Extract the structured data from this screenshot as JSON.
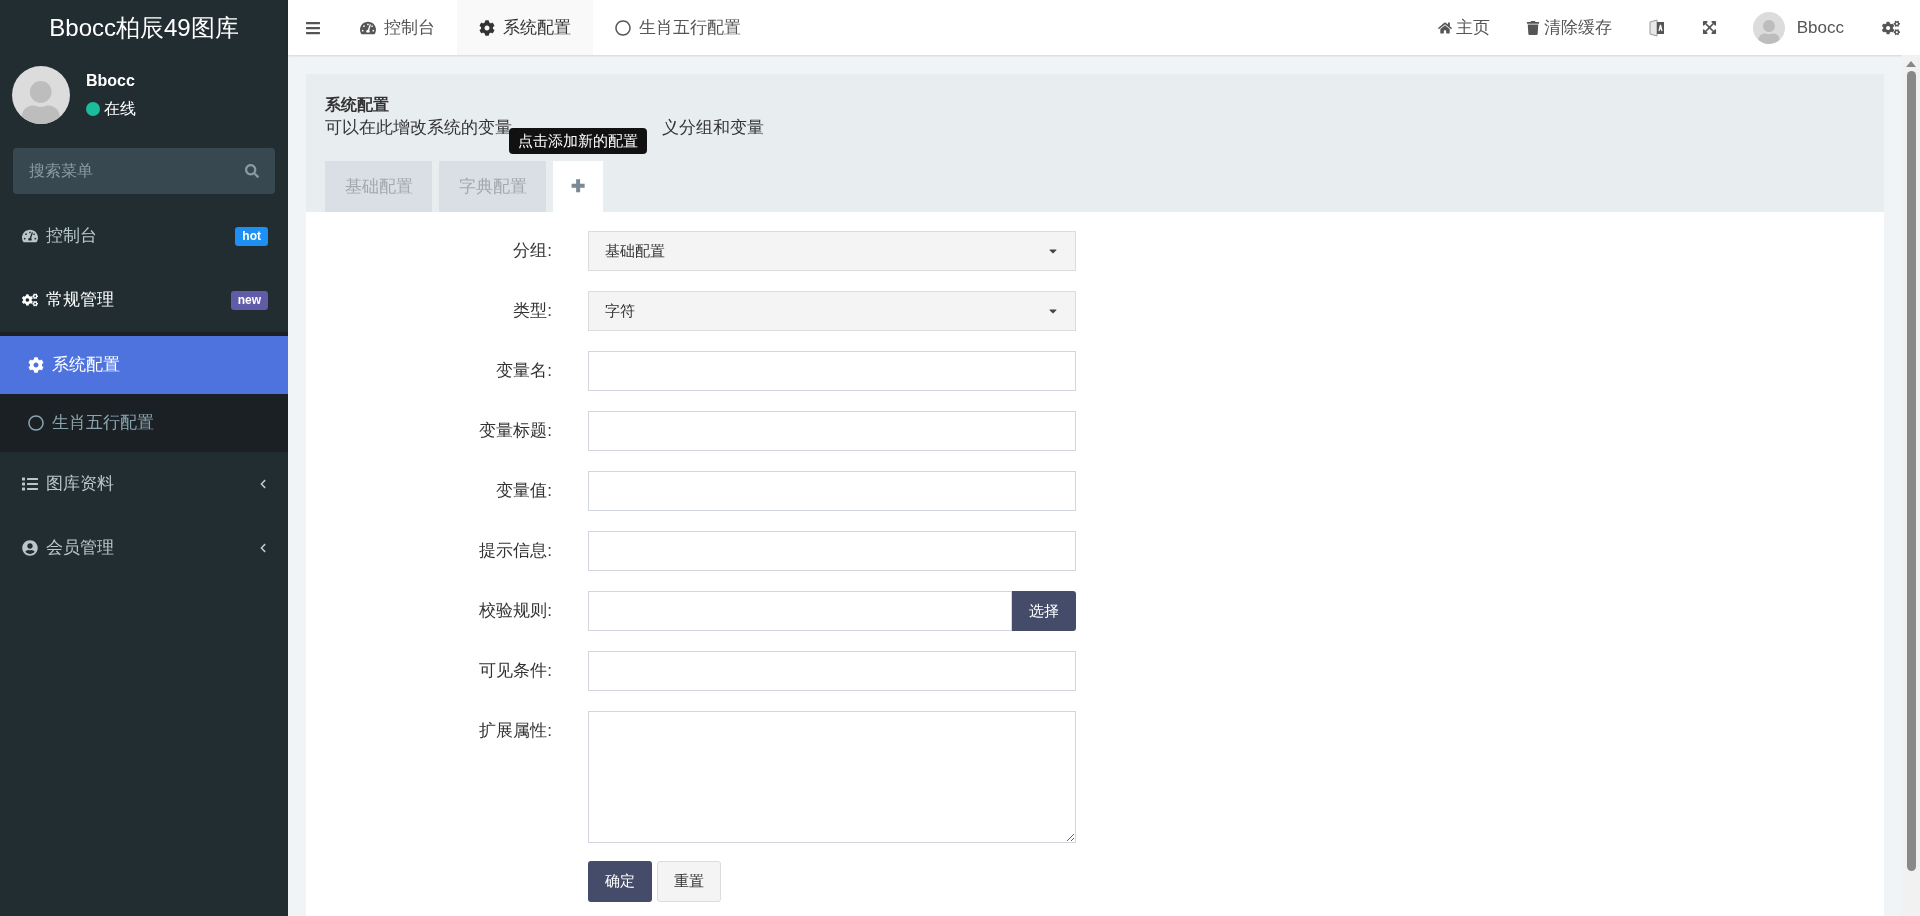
{
  "sidebar": {
    "logo": "Bbocc柏辰49图库",
    "user": {
      "name": "Bbocc",
      "status": "在线",
      "online": true
    },
    "search": {
      "placeholder": "搜索菜单"
    },
    "items": [
      {
        "label": "控制台",
        "badge": "hot",
        "color": "#1e90f4",
        "selected": false
      },
      {
        "label": "常规管理",
        "badge": "new",
        "color": "#605ca8",
        "selected": false,
        "expanded": true,
        "children": [
          {
            "label": "系统配置",
            "selected": true
          },
          {
            "label": "生肖五行配置",
            "selected": false
          }
        ]
      },
      {
        "label": "图库资料",
        "selected": false,
        "expanded": false
      },
      {
        "label": "会员管理",
        "selected": false,
        "expanded": false
      }
    ]
  },
  "topbar": {
    "tabs": [
      {
        "label": "控制台",
        "selected": false
      },
      {
        "label": "系统配置",
        "selected": true
      },
      {
        "label": "生肖五行配置",
        "selected": false
      }
    ],
    "links": [
      {
        "label": "主页"
      },
      {
        "label": "清除缓存"
      }
    ],
    "user": "Bbocc"
  },
  "panel": {
    "title": "系统配置",
    "subtitle_start": "可以在此增改系统的变量",
    "subtitle_end": "义分组和变量",
    "tooltip": "点击添加新的配置",
    "tabs": [
      {
        "label": "基础配置",
        "selected": false
      },
      {
        "label": "字典配置",
        "selected": false
      },
      {
        "label": "✚",
        "selected": true
      }
    ]
  },
  "form": {
    "rows": [
      {
        "label": "分组:",
        "kind": "select",
        "value": "基础配置"
      },
      {
        "label": "类型:",
        "kind": "select",
        "value": "字符"
      },
      {
        "label": "变量名:",
        "kind": "input"
      },
      {
        "label": "变量标题:",
        "kind": "input"
      },
      {
        "label": "变量值:",
        "kind": "input"
      },
      {
        "label": "提示信息:",
        "kind": "input"
      },
      {
        "label": "校验规则:",
        "kind": "input_button",
        "button": "选择"
      },
      {
        "label": "可见条件:",
        "kind": "input"
      },
      {
        "label": "扩展属性:",
        "kind": "textarea"
      }
    ],
    "buttons": [
      {
        "label": "确定",
        "kind": "primary"
      },
      {
        "label": "重置",
        "kind": "default"
      }
    ]
  }
}
